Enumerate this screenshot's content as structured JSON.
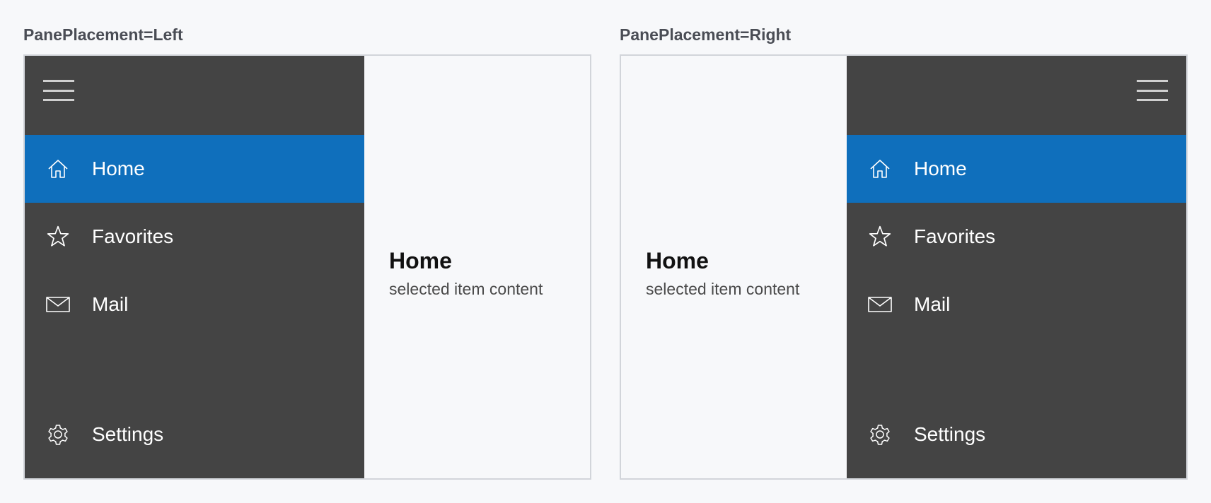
{
  "demos": [
    {
      "caption": "PanePlacement=Left",
      "nav": {
        "items": [
          {
            "label": "Home",
            "icon": "home-icon",
            "selected": true
          },
          {
            "label": "Favorites",
            "icon": "star-icon",
            "selected": false
          },
          {
            "label": "Mail",
            "icon": "mail-icon",
            "selected": false
          }
        ],
        "footer": {
          "label": "Settings",
          "icon": "gear-icon"
        }
      },
      "content": {
        "title": "Home",
        "subtitle": "selected item content"
      }
    },
    {
      "caption": "PanePlacement=Right",
      "nav": {
        "items": [
          {
            "label": "Home",
            "icon": "home-icon",
            "selected": true
          },
          {
            "label": "Favorites",
            "icon": "star-icon",
            "selected": false
          },
          {
            "label": "Mail",
            "icon": "mail-icon",
            "selected": false
          }
        ],
        "footer": {
          "label": "Settings",
          "icon": "gear-icon"
        }
      },
      "content": {
        "title": "Home",
        "subtitle": "selected item content"
      }
    }
  ],
  "colors": {
    "pane_background": "#444444",
    "selected_item": "#0f6fbc",
    "page_background": "#f7f8fa",
    "frame_border": "#d2d5da"
  }
}
